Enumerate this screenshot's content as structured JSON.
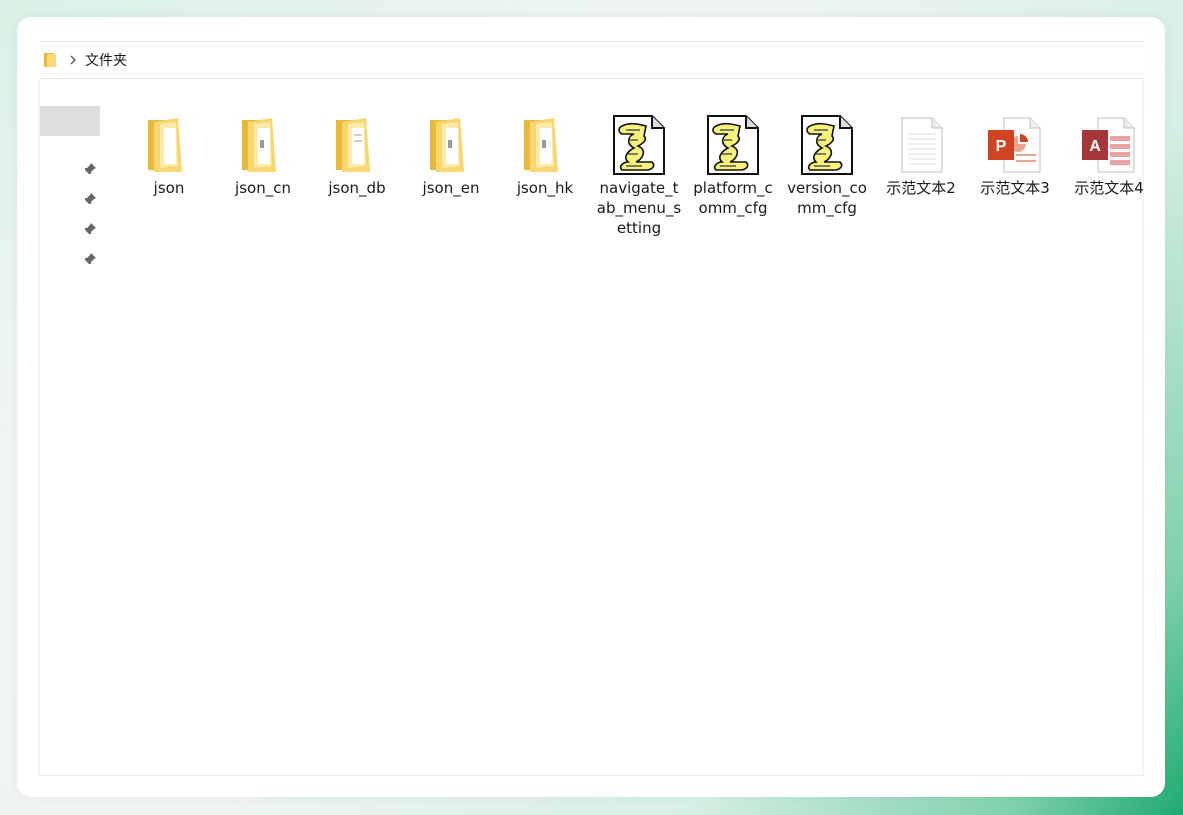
{
  "address_bar": {
    "breadcrumb": "文件夹"
  },
  "colors": {
    "accent": "#1faa72",
    "folder_yellow": "#f7d66f",
    "powerpoint": "#d04423",
    "access": "#a4373a",
    "selection": "#dedede"
  },
  "nav_pane": {
    "pins": [
      "pin-icon",
      "pin-icon",
      "pin-icon",
      "pin-icon"
    ]
  },
  "items": [
    {
      "name": "json",
      "icon": "folder-icon"
    },
    {
      "name": "json_cn",
      "icon": "folder-icon"
    },
    {
      "name": "json_db",
      "icon": "folder-icon"
    },
    {
      "name": "json_en",
      "icon": "folder-icon"
    },
    {
      "name": "json_hk",
      "icon": "folder-icon"
    },
    {
      "name": "navigate_tab_menu_setting",
      "icon": "script-icon"
    },
    {
      "name": "platform_comm_cfg",
      "icon": "script-icon"
    },
    {
      "name": "version_comm_cfg",
      "icon": "script-icon"
    },
    {
      "name": "示范文本2",
      "icon": "text-file-icon"
    },
    {
      "name": "示范文本3",
      "icon": "powerpoint-icon"
    },
    {
      "name": "示范文本4",
      "icon": "access-icon"
    }
  ]
}
